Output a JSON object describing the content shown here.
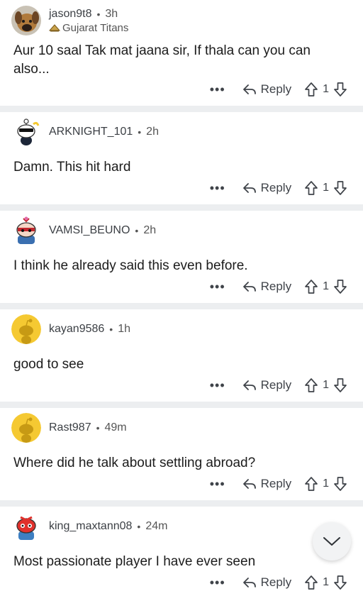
{
  "comments": [
    {
      "username": "jason9t8",
      "time": "3h",
      "flair": "Gujarat Titans",
      "text": "Aur 10 saal Tak mat jaana sir, If thala can you can also...",
      "reply_label": "Reply",
      "votes": "1",
      "more": "•••"
    },
    {
      "username": "ARKNIGHT_101",
      "time": "2h",
      "text": "Damn. This hit hard",
      "reply_label": "Reply",
      "votes": "1",
      "more": "•••"
    },
    {
      "username": "VAMSI_BEUNO",
      "time": "2h",
      "text": "I think he already said this even before.",
      "reply_label": "Reply",
      "votes": "1",
      "more": "•••"
    },
    {
      "username": "kayan9586",
      "time": "1h",
      "text": "good to see",
      "reply_label": "Reply",
      "votes": "1",
      "more": "•••"
    },
    {
      "username": "Rast987",
      "time": "49m",
      "text": "Where did he talk about settling abroad?",
      "reply_label": "Reply",
      "votes": "1",
      "more": "•••"
    },
    {
      "username": "king_maxtann08",
      "time": "24m",
      "text": "Most passionate player I have ever seen",
      "reply_label": "Reply",
      "votes": "1",
      "more": "•••"
    }
  ],
  "separator_dot": "•",
  "icons": {
    "reply": "reply-arrow-icon",
    "upvote": "upvote-arrow-icon",
    "downvote": "downvote-arrow-icon",
    "scroll": "chevron-down-icon"
  },
  "colors": {
    "separator": "#eceef0",
    "snoo_yellow": "#f5c932",
    "text": "#1c1c1c",
    "meta": "#555555"
  }
}
